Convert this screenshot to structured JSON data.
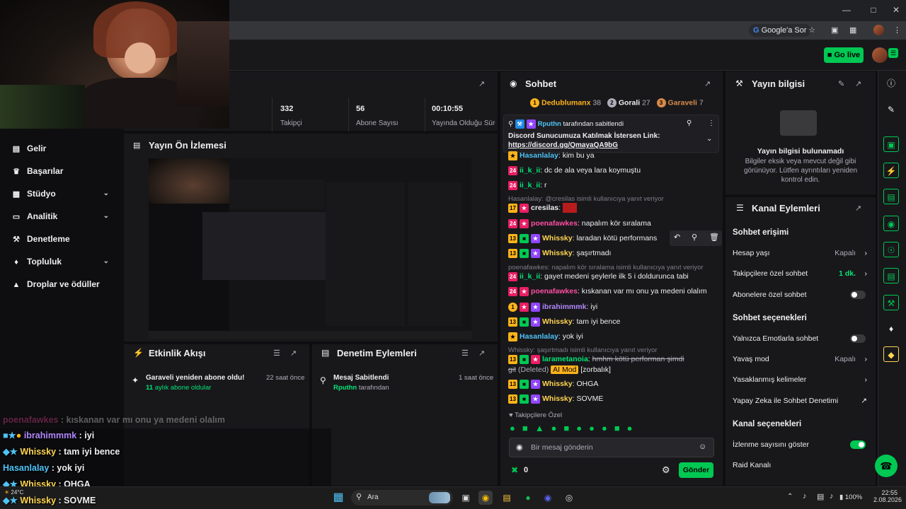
{
  "browser": {
    "google_search": "Google'a Sor"
  },
  "topbar": {
    "go_live": "Go live"
  },
  "sidebar": {
    "items": [
      {
        "label": "Gelir",
        "icon": "revenue-icon",
        "chevron": false
      },
      {
        "label": "Başarılar",
        "icon": "trophy-icon",
        "chevron": false
      },
      {
        "label": "Stüdyo",
        "icon": "studio-icon",
        "chevron": true
      },
      {
        "label": "Analitik",
        "icon": "analytics-icon",
        "chevron": true
      },
      {
        "label": "Denetleme",
        "icon": "moderation-icon",
        "chevron": false
      },
      {
        "label": "Topluluk",
        "icon": "community-icon",
        "chevron": true
      },
      {
        "label": "Droplar ve ödüller",
        "icon": "drops-icon",
        "chevron": false
      }
    ]
  },
  "stats": [
    {
      "value": "332",
      "label": "Takipçi"
    },
    {
      "value": "56",
      "label": "Abone Sayısı"
    },
    {
      "value": "00:10:55",
      "label": "Yayında Olduğu Süre"
    }
  ],
  "preview": {
    "title": "Yayın Ön İzlemesi"
  },
  "activity": {
    "title": "Etkinlik Akışı",
    "item_title": "Garaveli yeniden abone oldu!",
    "item_sub_count": "11",
    "item_sub_text": "aylık abone oldular",
    "item_time": "22 saat önce"
  },
  "mod_actions": {
    "title": "Denetim Eylemleri",
    "item_title": "Mesaj Sabitlendi",
    "item_user": "Rputhn",
    "item_sub": "tarafından",
    "item_time": "1 saat önce"
  },
  "chat": {
    "title": "Sohbet",
    "leaderboard": [
      {
        "rank": "1",
        "name": "Dedublumanx",
        "count": "38",
        "color": "#ffb31a"
      },
      {
        "rank": "2",
        "name": "Gorali",
        "count": "27",
        "color": "#adadb8"
      },
      {
        "rank": "3",
        "name": "Garaveli",
        "count": "7",
        "color": "#d88a48"
      }
    ],
    "pinned": {
      "by_user": "Rputhn",
      "by_text": "tarafından sabitlendi",
      "message": "Discord Sunucumuza Katılmak İstersen Link:",
      "link": "https://discord.gg/QmayaQA9bG"
    },
    "messages": [
      {
        "reply": "",
        "badges": "",
        "user": "Hasanlalay",
        "color": "#4fc3f7",
        "text": "kim bu ya"
      },
      {
        "reply": "",
        "badges": "",
        "user": "ii_k_ii",
        "color": "#00e676",
        "text": "dc de ala veya lara koymuştu"
      },
      {
        "reply": "",
        "badges": "",
        "user": "ii_k_ii",
        "color": "#00e676",
        "text": "r"
      },
      {
        "reply": "Hasanlalay: @cresilas isimli kullanıcıya yanıt veriyor",
        "badges": "17",
        "user": "cresilas",
        "color": "#efeff1",
        "text": ""
      },
      {
        "reply": "",
        "badges": "",
        "user": "poenafawkes",
        "color": "#ff4fa3",
        "text": "napalım kör sıralama"
      },
      {
        "reply": "",
        "badges": "13",
        "user": "Whissky",
        "color": "#ffd54f",
        "text": "laradan kötü performans"
      },
      {
        "reply": "",
        "badges": "13",
        "user": "Whissky",
        "color": "#ffd54f",
        "text": "şaşırtmadı"
      },
      {
        "reply": "poenafawkes: napalım kör sıralama isimli kullanıcıya yanıt veriyor",
        "badges": "",
        "user": "ii_k_ii",
        "color": "#00e676",
        "text": "gayet medeni şeylerle ilk 5 i doldurunca tabi"
      },
      {
        "reply": "",
        "badges": "",
        "user": "poenafawkes",
        "color": "#ff4fa3",
        "text": "kıskanan var mı onu ya medeni olalım"
      },
      {
        "reply": "",
        "badges": "1",
        "user": "ibrahimmmk",
        "color": "#b388ff",
        "text": "iyi"
      },
      {
        "reply": "",
        "badges": "13",
        "user": "Whissky",
        "color": "#ffd54f",
        "text": "tam iyi bence"
      },
      {
        "reply": "",
        "badges": "",
        "user": "Hasanlalay",
        "color": "#4fc3f7",
        "text": "yok iyi"
      },
      {
        "reply": "Whissky: şaşırtmadı isimli kullanıcıya yanıt veriyor",
        "badges": "13",
        "user": "larametanoia",
        "color": "#00e676",
        "text": "hmhm kötü performan şimdi"
      },
      {
        "reply": "",
        "badges": "13",
        "user": "Whissky",
        "color": "#ffd54f",
        "text": "OHGA"
      },
      {
        "reply": "",
        "badges": "13",
        "user": "Whissky",
        "color": "#ffd54f",
        "text": "SOVME"
      }
    ],
    "deleted_prefix": "git",
    "deleted_label": "(Deleted)",
    "ai_mod": "AI Mod",
    "zorbalik": "[zorbalık]",
    "subs_only_label": "Takipçilere Özel",
    "input_placeholder": "Bir mesaj gönderin",
    "points": "0",
    "send_label": "Gönder"
  },
  "stream_info": {
    "title": "Yayın bilgisi",
    "empty_title": "Yayın bilgisi bulunamadı",
    "empty_desc": "Bilgiler eksik veya mevcut değil gibi görünüyor. Lütfen ayrıntıları yeniden kontrol edin."
  },
  "channel_actions": {
    "title": "Kanal Eylemleri",
    "section_chat_access": "Sohbet erişimi",
    "account_age": "Hesap yaşı",
    "account_age_val": "Kapalı",
    "followers_only": "Takipçilere özel sohbet",
    "followers_only_val": "1 dk.",
    "subs_only": "Abonelere özel sohbet",
    "section_chat_options": "Sohbet seçenekleri",
    "emote_only": "Yalnızca Emotlarla sohbet",
    "slow_mode": "Yavaş mod",
    "slow_mode_val": "Kapalı",
    "banned_words": "Yasaklanmış kelimeler",
    "ai_moderation": "Yapay Zeka ile Sohbet Denetimi",
    "section_channel_options": "Kanal seçenekleri",
    "show_viewers": "İzlenme sayısını göster",
    "raid_channel": "Raid Kanalı"
  },
  "overlay_chat": [
    {
      "user": "poenafawkes",
      "color": "#ff4fa3",
      "text": " : kıskanan var mı onu ya medeni olalım",
      "dim": true
    },
    {
      "user": "ibrahimmmk",
      "color": "#b388ff",
      "text": " : iyi",
      "dim": false
    },
    {
      "user": "Whissky",
      "color": "#ffd54f",
      "text": " : tam iyi bence",
      "dim": false
    },
    {
      "user": "Hasanlalay",
      "color": "#4fc3f7",
      "text": " : yok iyi",
      "dim": false
    },
    {
      "user": "Whissky",
      "color": "#ffd54f",
      "text": " : OHGA",
      "dim": false
    },
    {
      "user": "Whissky",
      "color": "#ffd54f",
      "text": " : SOVME",
      "dim": false
    }
  ],
  "taskbar": {
    "search": "Ara",
    "weather": "24°C",
    "battery": "100%",
    "time": "22:55",
    "date": "2.08.2026"
  }
}
